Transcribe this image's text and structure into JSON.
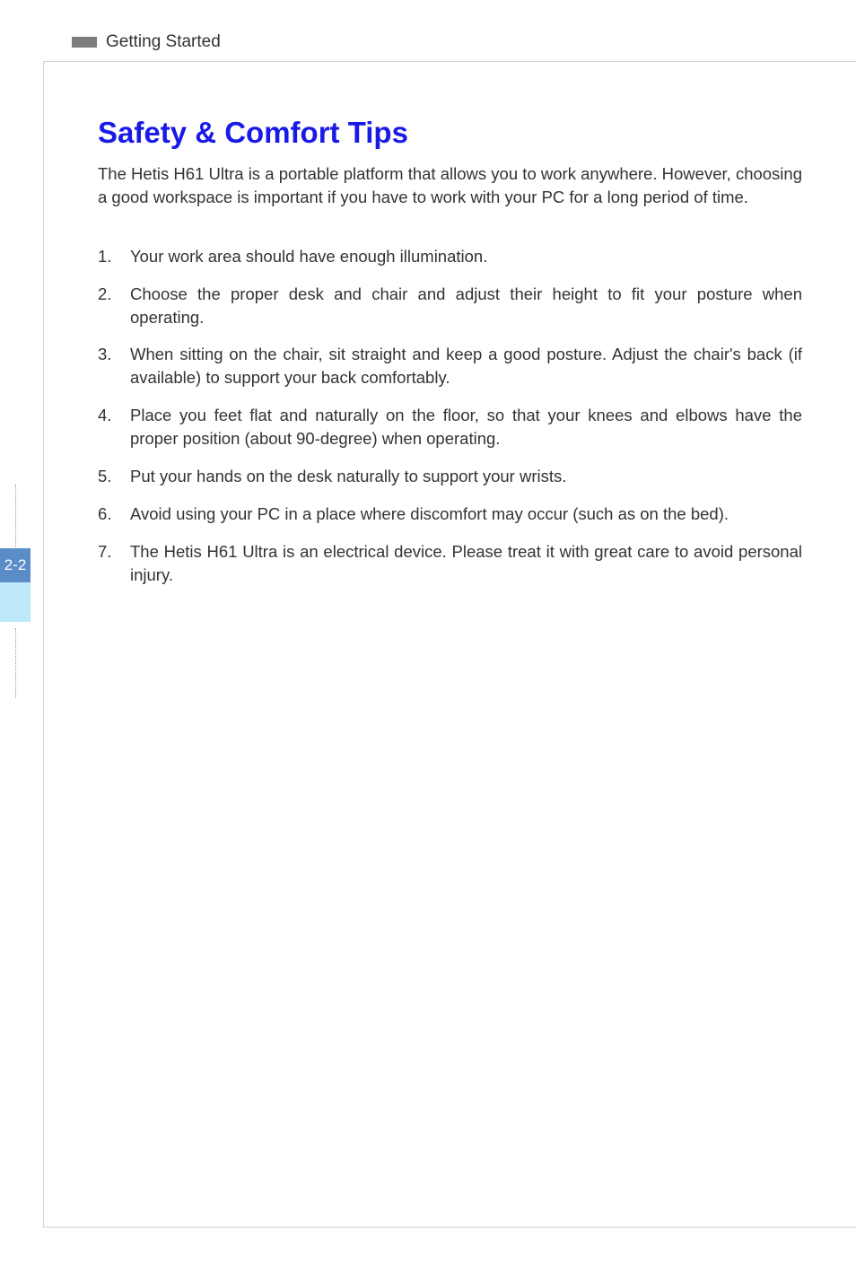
{
  "header": {
    "section": "Getting Started"
  },
  "title": "Safety & Comfort Tips",
  "intro": "The Hetis H61 Ultra is a portable platform that allows you to work anywhere. However, choosing a good workspace is important if you have to work with your PC for a long period of time.",
  "tips": [
    "Your work area should have enough illumination.",
    "Choose the proper desk and chair and adjust their height to fit your posture when operating.",
    "When sitting on the chair, sit straight and keep a good posture. Adjust the chair's back (if available) to support your back comfortably.",
    "Place you feet flat and naturally on the floor, so that your knees and elbows have the proper position (about 90-degree) when operating.",
    "Put your hands on the desk naturally to support your wrists.",
    "Avoid using your PC in a place where discomfort may occur (such as on the bed).",
    "The Hetis H61 Ultra is an electrical device. Please treat it with great care to avoid personal injury."
  ],
  "page_number": "2-2"
}
